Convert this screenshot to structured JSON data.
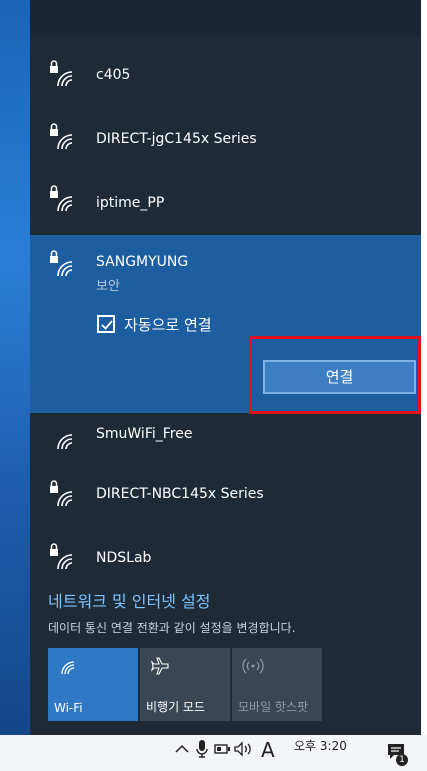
{
  "networks": [
    {
      "name": "c405",
      "secured": true
    },
    {
      "name": "DIRECT-jgC145x Series",
      "secured": true
    },
    {
      "name": "iptime_PP",
      "secured": true
    },
    {
      "name": "SANGMYUNG",
      "secured": true,
      "status": "보안",
      "auto_connect_label": "자동으로 연결",
      "auto_connect": true,
      "connect_label": "연결"
    },
    {
      "name": "SmuWiFi_Free",
      "secured": false
    },
    {
      "name": "DIRECT-NBC145x Series",
      "secured": true
    },
    {
      "name": "NDSLab",
      "secured": true
    }
  ],
  "settings": {
    "link": "네트워크 및 인터넷 설정",
    "description": "데이터 통신 연결 전환과 같이 설정을 변경합니다."
  },
  "quick_actions": [
    {
      "label": "Wi-Fi",
      "icon": "wifi-icon",
      "state": "on"
    },
    {
      "label": "비행기 모드",
      "icon": "airplane-icon",
      "state": "off"
    },
    {
      "label": "모바일 핫스팟",
      "icon": "hotspot-icon",
      "state": "disabled"
    }
  ],
  "taskbar": {
    "ime": "A",
    "clock": "오후 3:20",
    "notification_count": "1"
  },
  "colors": {
    "flyout_bg": "#1f2a37",
    "selected_bg": "#1d5ea0",
    "accent": "#2e78c6",
    "link": "#7cc3ff",
    "highlight_box": "#e0101e"
  }
}
